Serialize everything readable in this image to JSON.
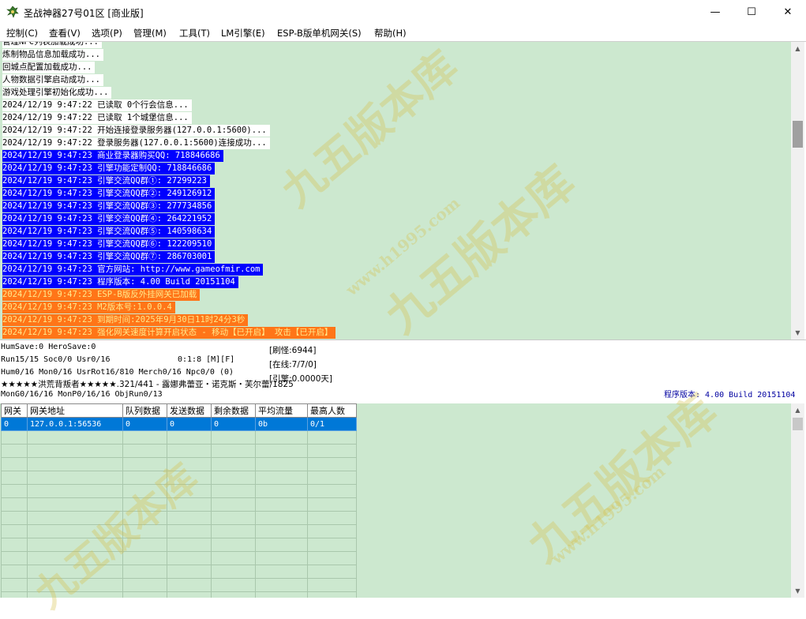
{
  "window": {
    "title": "圣战神器27号01区 [商业版]",
    "controls": {
      "minimize": "—",
      "maximize": "☐",
      "close": "✕"
    }
  },
  "menu": [
    "控制(C)",
    "查看(V)",
    "选项(P)",
    "管理(M)",
    "工具(T)",
    "LM引擎(E)",
    "ESP-B版单机网关(S)",
    "帮助(H)"
  ],
  "log": [
    {
      "text": "管理NPC列表加载成功...",
      "style": "white"
    },
    {
      "text": "炼制物品信息加载成功...",
      "style": "white"
    },
    {
      "text": "回城点配置加载成功...",
      "style": "white"
    },
    {
      "text": "人物数据引擎启动成功...",
      "style": "white"
    },
    {
      "text": "游戏处理引擎初始化成功...",
      "style": "white"
    },
    {
      "text": "2024/12/19 9:47:22 已读取 0个行会信息...",
      "style": "white"
    },
    {
      "text": "2024/12/19 9:47:22 已读取 1个城堡信息...",
      "style": "white"
    },
    {
      "text": "2024/12/19 9:47:22 开始连接登录服务器(127.0.0.1:5600)...",
      "style": "white"
    },
    {
      "text": "2024/12/19 9:47:22 登录服务器(127.0.0.1:5600)连接成功...",
      "style": "white"
    },
    {
      "text": "2024/12/19 9:47:23 商业登录器购买QQ: 718846686",
      "style": "blue"
    },
    {
      "text": "2024/12/19 9:47:23 引擎功能定制QQ: 718846686",
      "style": "blue"
    },
    {
      "text": "2024/12/19 9:47:23 引擎交流QQ群①: 27299223",
      "style": "blue"
    },
    {
      "text": "2024/12/19 9:47:23 引擎交流QQ群②: 249126912",
      "style": "blue"
    },
    {
      "text": "2024/12/19 9:47:23 引擎交流QQ群③: 277734856",
      "style": "blue"
    },
    {
      "text": "2024/12/19 9:47:23 引擎交流QQ群④: 264221952",
      "style": "blue"
    },
    {
      "text": "2024/12/19 9:47:23 引擎交流QQ群⑤: 140598634",
      "style": "blue"
    },
    {
      "text": "2024/12/19 9:47:23 引擎交流QQ群⑥: 122209510",
      "style": "blue"
    },
    {
      "text": "2024/12/19 9:47:23 引擎交流QQ群⑦: 286703001",
      "style": "blue"
    },
    {
      "text": "2024/12/19 9:47:23 官方网站: http://www.gameofmir.com",
      "style": "blue"
    },
    {
      "text": "2024/12/19 9:47:23 程序版本: 4.00 Build 20151104",
      "style": "blue"
    },
    {
      "text": "2024/12/19 9:47:23 ESP-B版反外挂网关已加载",
      "style": "orange"
    },
    {
      "text": "2024/12/19 9:47:23 M2版本号:1.0.0.4",
      "style": "orange"
    },
    {
      "text": "2024/12/19 9:47:23 到期时间:2025年9月30日11时24分3秒",
      "style": "orange"
    },
    {
      "text": "2024/12/19 9:47:23 强化网关速度计算开启状态 - 移动【已开启】 攻击【已开启】",
      "style": "orange"
    }
  ],
  "status": {
    "save": "HumSave:0 HeroSave:0",
    "run": "Run15/15 Soc0/0 Usr0/16",
    "ratio": "0:1:8 [M][F]",
    "hum": "Hum0/16 Mon0/16 UsrRot16/810 Merch0/16 Npc0/0 (0)",
    "mon": "MonG0/16/16 MonP0/16/16 ObjRun0/13",
    "refresh": "[刷怪:6944]",
    "online": "[在线:7/7/0]",
    "engine": "[引擎:0.0000天]",
    "notice": "★★★★★洪荒背叛者★★★★★.321/441 - 露娜弗蕾亚・诺克斯・芙尔蕾/1825",
    "version": "程序版本: 4.00 Build 20151104"
  },
  "gateway_table": {
    "columns": [
      "网关",
      "网关地址",
      "队列数据",
      "发送数据",
      "剩余数据",
      "平均流量",
      "最高人数"
    ],
    "rows": [
      [
        "0",
        "127.0.0.1:56536",
        "0",
        "0",
        "0",
        "0b",
        "0/1"
      ]
    ],
    "empty_rows": 13
  },
  "watermark": {
    "text": "九五版本库",
    "url": "www.h1995.com"
  },
  "colors": {
    "log_bg": "#cce8cf",
    "blue_line": "#0000ff",
    "orange_line": "#ff7518",
    "orange_text": "#ffe88a",
    "selection": "#0078d7"
  }
}
